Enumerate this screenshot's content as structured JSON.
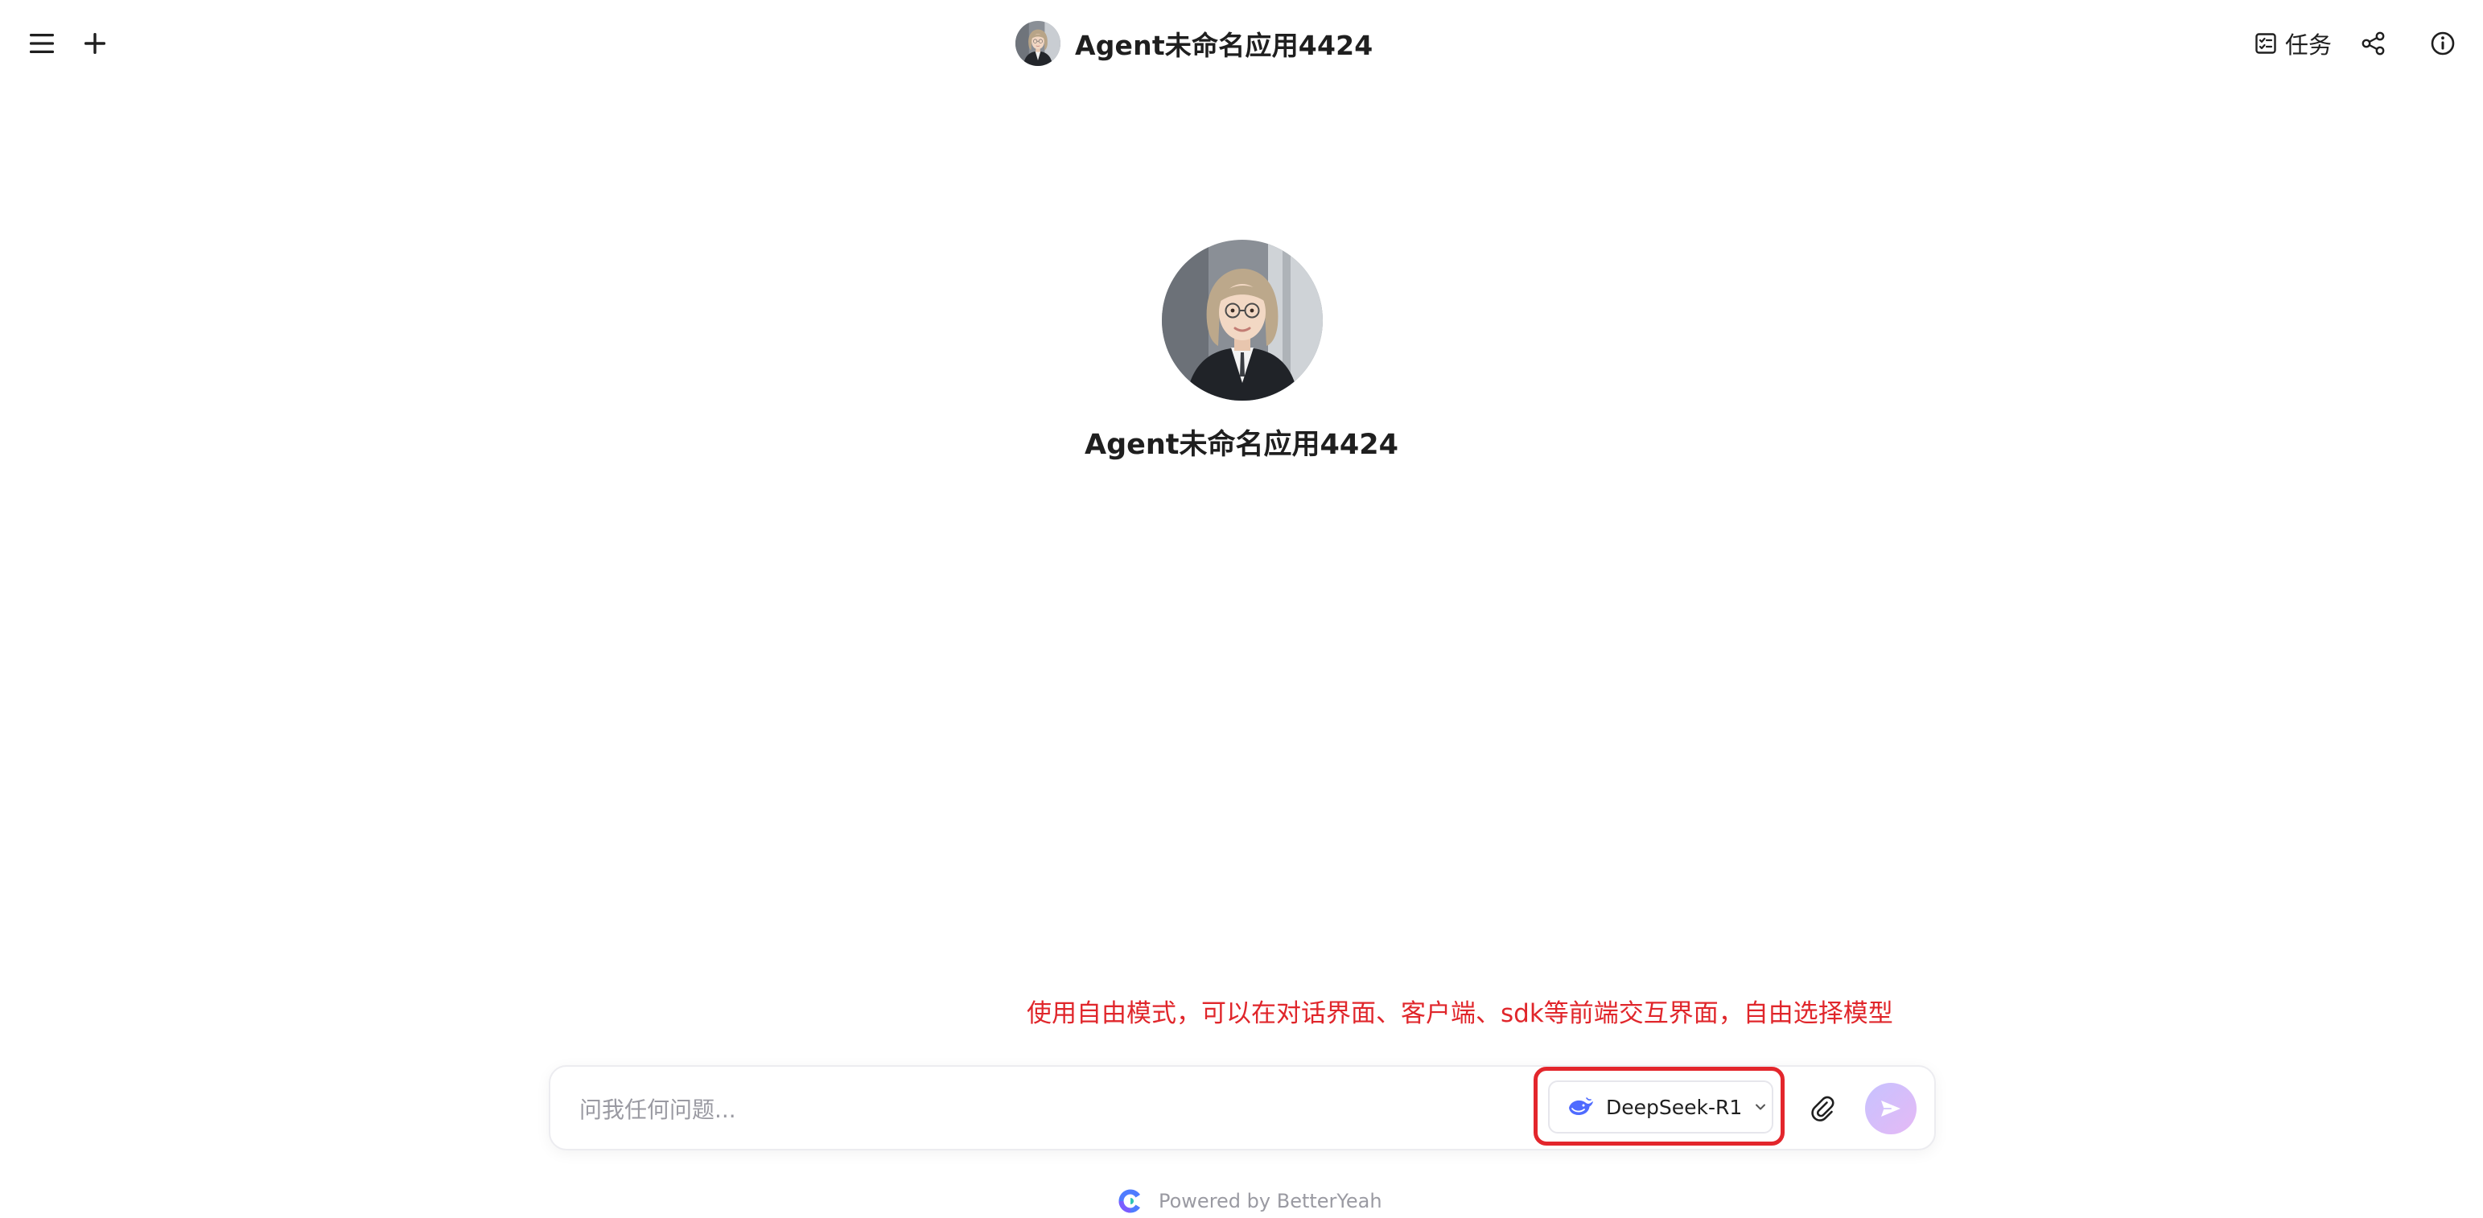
{
  "header": {
    "app_title": "Agent未命名应用4424",
    "task_label": "任务"
  },
  "hero": {
    "app_name": "Agent未命名应用4424"
  },
  "annotation": {
    "text": "使用自由模式，可以在对话界面、客户端、sdk等前端交互界面，自由选择模型",
    "color": "#e0262b"
  },
  "input": {
    "value": "",
    "placeholder": "问我任何问题..."
  },
  "model": {
    "selected": "DeepSeek-R1",
    "icon": "deepseek-whale-icon"
  },
  "footer": {
    "powered_by": "Powered by BetterYeah"
  },
  "icons": {
    "menu": "menu-icon",
    "new_chat": "plus-icon",
    "task": "task-list-icon",
    "share": "share-icon",
    "info": "info-icon",
    "attach": "paperclip-icon",
    "send": "send-icon",
    "brand": "betteryeah-logo-icon"
  },
  "colors": {
    "highlight": "#e3262c",
    "send_gradient_start": "#c7c2ff",
    "send_gradient_end": "#e5b9f5",
    "brand_blue": "#4f7cff"
  }
}
